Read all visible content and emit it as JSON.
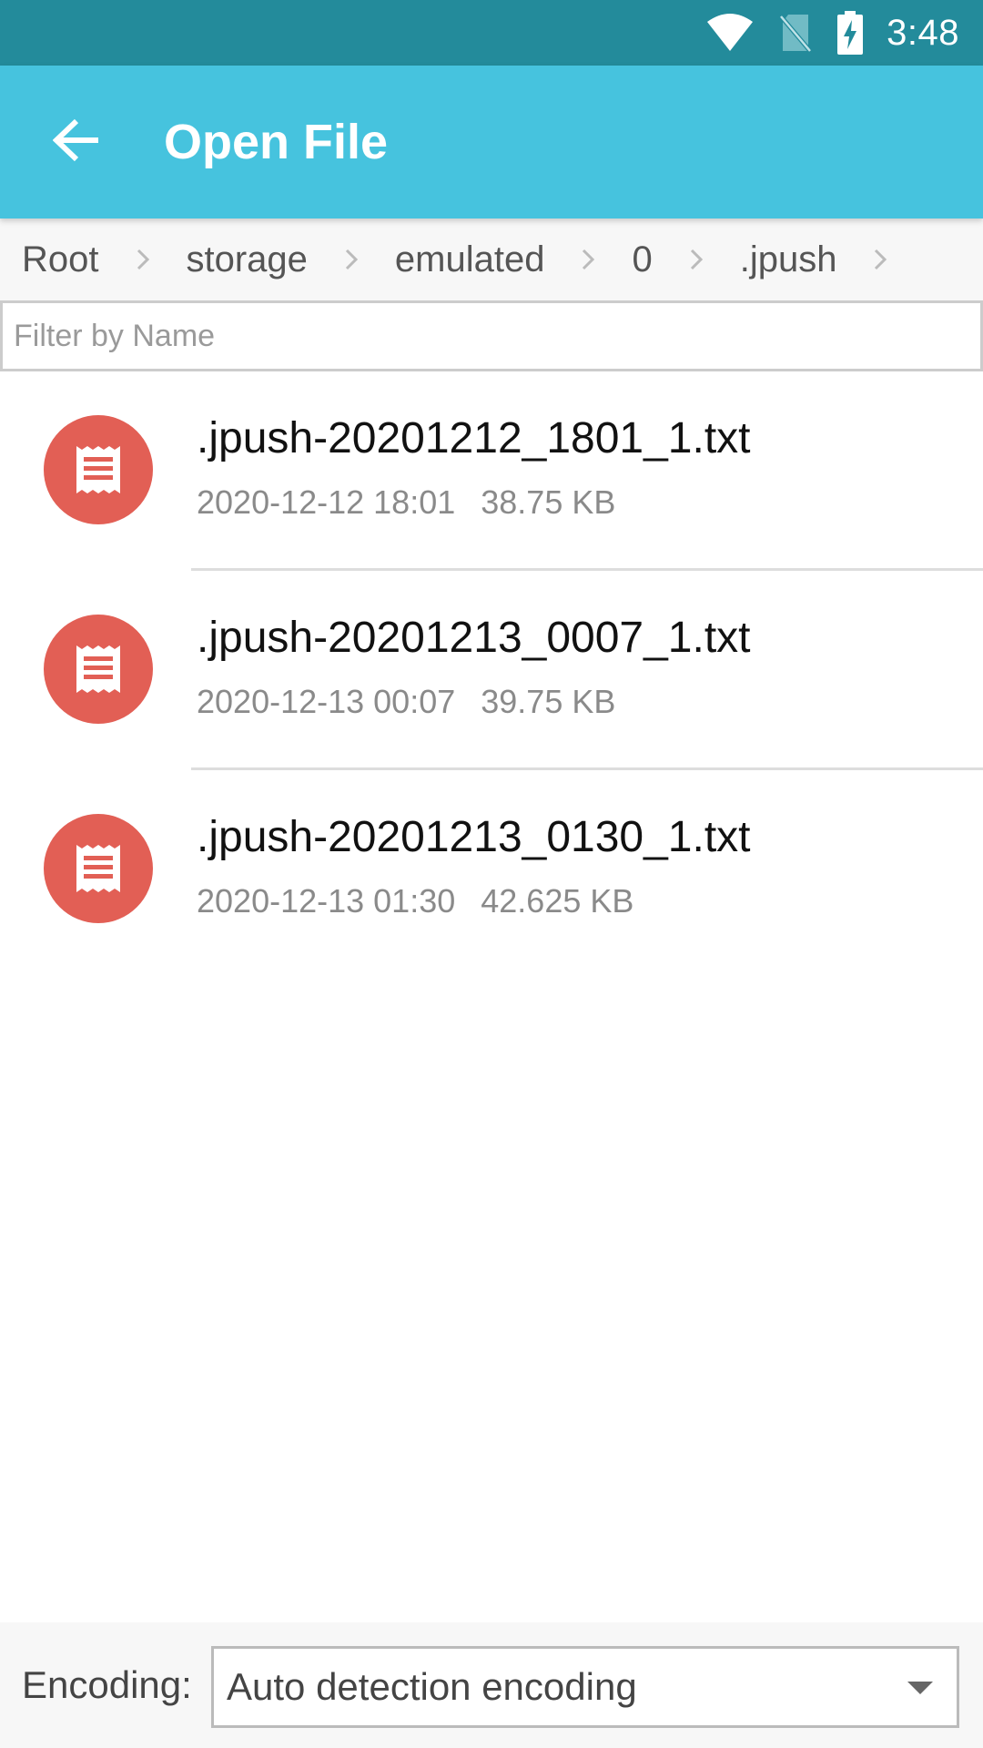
{
  "status_bar": {
    "time": "3:48",
    "icons": [
      "wifi-icon",
      "no-sim-icon",
      "battery-charging-icon"
    ],
    "color": "#238b9b"
  },
  "app_bar": {
    "title": "Open File",
    "back_icon": "arrow-back-icon",
    "color": "#46c3de"
  },
  "breadcrumb": {
    "items": [
      "Root",
      "storage",
      "emulated",
      "0",
      ".jpush"
    ],
    "separator_icon": "chevron-right-icon"
  },
  "filter": {
    "placeholder": "Filter by Name",
    "value": ""
  },
  "files": [
    {
      "name": ".jpush-20201212_1801_1.txt",
      "date": "2020-12-12 18:01",
      "size": "38.75 KB",
      "icon": "text-file-icon"
    },
    {
      "name": ".jpush-20201213_0007_1.txt",
      "date": "2020-12-13 00:07",
      "size": "39.75 KB",
      "icon": "text-file-icon"
    },
    {
      "name": ".jpush-20201213_0130_1.txt",
      "date": "2020-12-13 01:30",
      "size": "42.625 KB",
      "icon": "text-file-icon"
    }
  ],
  "file_icon_color": "#e25f55",
  "encoding": {
    "label": "Encoding:",
    "selected": "Auto detection encoding",
    "arrow_icon": "dropdown-arrow-icon"
  }
}
